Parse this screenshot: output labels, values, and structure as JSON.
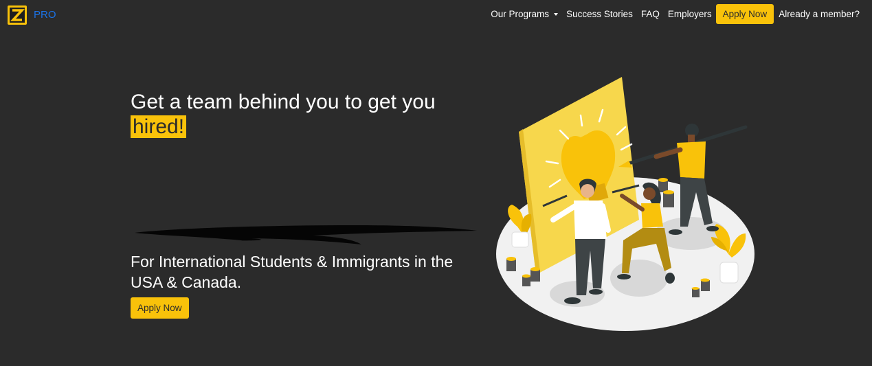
{
  "brand": {
    "name": "PRO"
  },
  "nav": {
    "items": [
      {
        "label": "Our Programs"
      },
      {
        "label": "Success Stories"
      },
      {
        "label": "FAQ"
      },
      {
        "label": "Employers"
      }
    ],
    "apply_label": "Apply Now",
    "member_label": "Already a member?"
  },
  "hero": {
    "headline_prefix": "Get a team behind you to get you",
    "headline_highlight": "hired!",
    "subtitle": "For International Students & Immigrants in the USA & Canada.",
    "cta_label": "Apply Now"
  },
  "colors": {
    "accent": "#f9c20a",
    "background": "#2b2b2b",
    "brand_text": "#1a73e8"
  }
}
